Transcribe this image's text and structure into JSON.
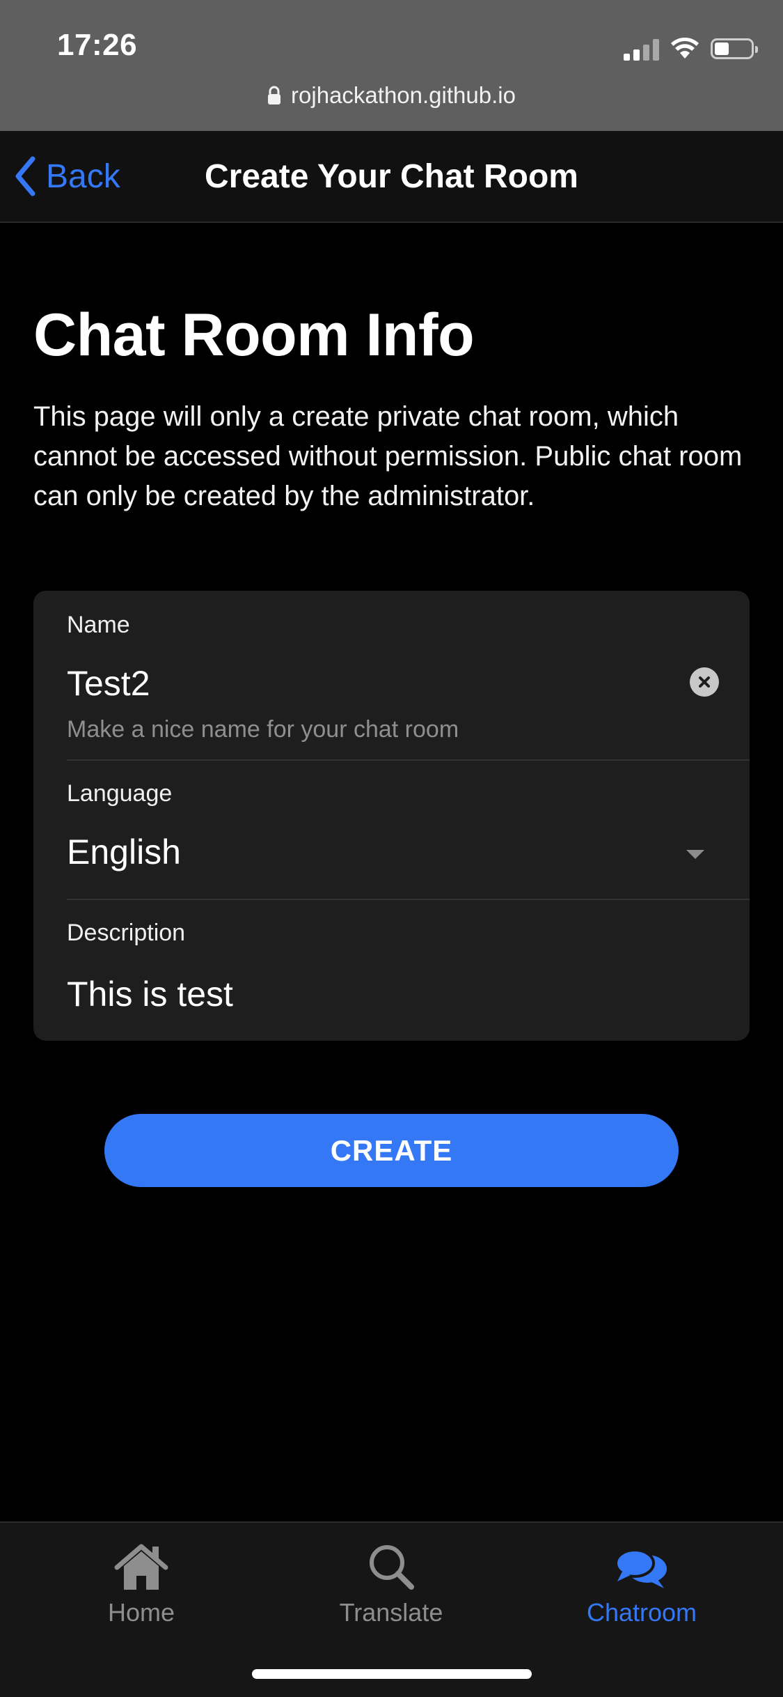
{
  "status_bar": {
    "time": "17:26",
    "url": "rojhackathon.github.io",
    "icons": [
      "signal-icon",
      "wifi-icon",
      "battery-icon",
      "lock-icon"
    ]
  },
  "nav": {
    "back_label": "Back",
    "title": "Create Your Chat Room"
  },
  "main": {
    "heading": "Chat Room Info",
    "intro": "This page will only a create private chat room, which cannot be accessed without permission. Public chat room can only be created by the administrator."
  },
  "form": {
    "name": {
      "label": "Name",
      "value": "Test2",
      "hint": "Make a nice name for your chat room"
    },
    "language": {
      "label": "Language",
      "value": "English"
    },
    "description": {
      "label": "Description",
      "value": "This is test"
    },
    "submit_label": "CREATE"
  },
  "tabs": [
    {
      "label": "Home",
      "icon": "home-icon",
      "active": false
    },
    {
      "label": "Translate",
      "icon": "search-icon",
      "active": false
    },
    {
      "label": "Chatroom",
      "icon": "chat-bubbles-icon",
      "active": true
    }
  ],
  "colors": {
    "accent": "#3478f6",
    "background": "#000000",
    "card": "#1e1e1e",
    "status_bar": "#5f5f5f"
  }
}
